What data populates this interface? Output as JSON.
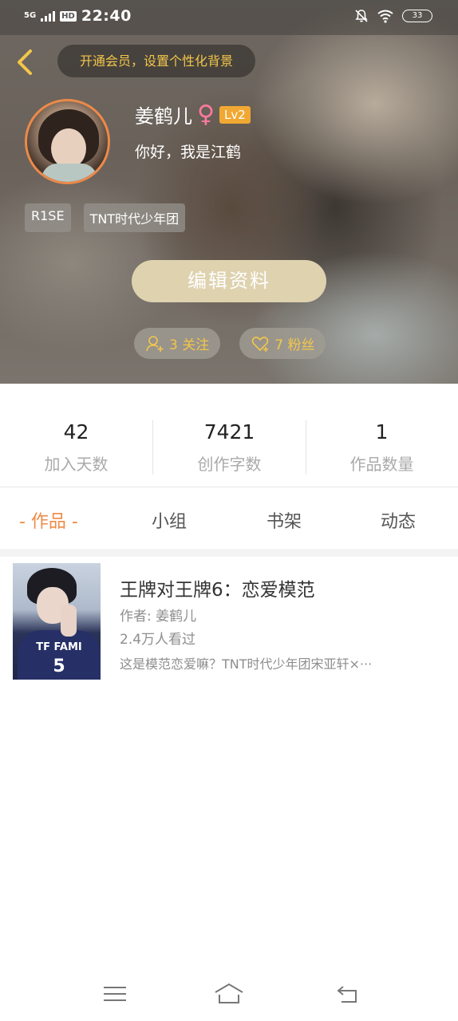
{
  "status_bar": {
    "network": "5G",
    "hd": "HD",
    "time": "22:40",
    "battery": "33"
  },
  "header": {
    "vip_banner": "开通会员，设置个性化背景",
    "name": "姜鹤儿",
    "gender_symbol": "♀",
    "level": "Lv2",
    "signature": "你好，我是江鹤",
    "tags": [
      "R1SE",
      "TNT时代少年团"
    ],
    "edit_button": "编辑资料",
    "following": "3 关注",
    "fans": "7 粉丝",
    "accent_color": "#f3c64a"
  },
  "stats": [
    {
      "value": "42",
      "label": "加入天数"
    },
    {
      "value": "7421",
      "label": "创作字数"
    },
    {
      "value": "1",
      "label": "作品数量"
    }
  ],
  "tabs": [
    "- 作品 -",
    "小组",
    "书架",
    "动态"
  ],
  "active_tab_color": "#ef8a47",
  "works": [
    {
      "title": "王牌对王牌6：恋爱模范",
      "author": "作者: 姜鹤儿",
      "views": "2.4万人看过",
      "description": "这是模范恋爱嘛？TNT时代少年团宋亚轩×···",
      "cover_text": "TF FAMI",
      "cover_number": "5"
    }
  ],
  "nav": {
    "menu_icon": "menu-icon",
    "home_icon": "home-icon",
    "back_icon": "back-icon"
  }
}
